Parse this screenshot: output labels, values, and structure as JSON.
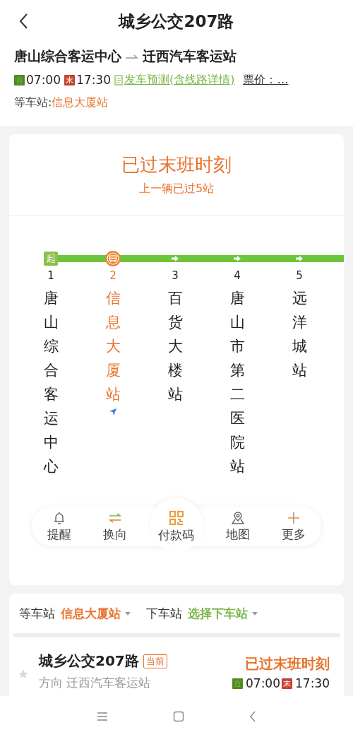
{
  "header": {
    "title": "城乡公交207路"
  },
  "route": {
    "from": "唐山综合客运中心",
    "to": "迁西汽车客运站"
  },
  "schedule": {
    "first_badge": "首",
    "first": "07:00",
    "last_badge": "末",
    "last": "17:30",
    "forecast_link": "发车预测(含线路详情)",
    "fare_link": "票价：…"
  },
  "waiting": {
    "label": "等车站: ",
    "station": "信息大厦站"
  },
  "status": {
    "title": "已过末班时刻",
    "subtitle": "上一辆已过5站"
  },
  "start_label": "起",
  "stops": [
    {
      "number": "1",
      "name": "唐山综合客运中心",
      "kind": "start",
      "selected": false
    },
    {
      "number": "2",
      "name": "信息大厦站",
      "kind": "waiting",
      "selected": true
    },
    {
      "number": "3",
      "name": "百货大楼站",
      "kind": "arrow",
      "selected": false
    },
    {
      "number": "4",
      "name": "唐山市第二医院站",
      "kind": "arrow",
      "selected": false
    },
    {
      "number": "5",
      "name": "远洋城站",
      "kind": "arrow",
      "selected": false
    }
  ],
  "actions": [
    {
      "label": "提醒",
      "kind": "bell"
    },
    {
      "label": "换向",
      "kind": "swap"
    },
    {
      "label": "付款码",
      "kind": "qr"
    },
    {
      "label": "地图",
      "kind": "map"
    },
    {
      "label": "更多",
      "kind": "more"
    }
  ],
  "selector": {
    "wait_label": "等车站",
    "wait_value": "信息大厦站",
    "alight_label": "下车站",
    "alight_value": "选择下车站"
  },
  "lines": [
    {
      "name": "城乡公交207路",
      "tag": "当前",
      "direction": "方向 迁西汽车客运站",
      "status": "已过末班时刻",
      "first_badge": "首",
      "first": "07:00",
      "last_badge": "末",
      "last": "17:30",
      "favorite": false
    }
  ]
}
